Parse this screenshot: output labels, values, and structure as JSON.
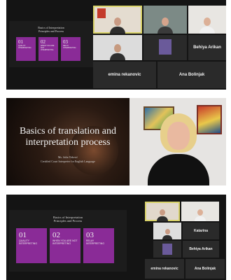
{
  "frame1": {
    "slide": {
      "title_line1": "Basics of Interpretation",
      "title_line2": "Principles and Process",
      "cards": [
        {
          "num": "01",
          "text": "Quality interpreting"
        },
        {
          "num": "02",
          "text": "When you are not interpreting"
        },
        {
          "num": "03",
          "text": "Relay interpreting"
        }
      ]
    },
    "participants": {
      "big_name_1": "Behiya Arikan",
      "big_name_2": "emina rekanovic",
      "big_name_3": "Ana Bolinjak"
    }
  },
  "frame2": {
    "slide": {
      "title": "Basics of translation and interpretation process",
      "presenter": "Ms. Julia Vidović",
      "role": "Certified Court Interpreter for English Language"
    }
  },
  "frame3": {
    "slide": {
      "title_line1": "Basics of Interpretation",
      "title_line2": "Principles and Process",
      "cards": [
        {
          "num": "01",
          "text": "Quality interpreting"
        },
        {
          "num": "02",
          "text": "When you are not interpreting"
        },
        {
          "num": "03",
          "text": "Relay interpreting"
        }
      ]
    },
    "participants": {
      "big_name_1": "Katarina",
      "big_name_2": "Behiya Arikan",
      "big_name_3": "emina rekanovic",
      "big_name_4": "Ana Bolinjak"
    }
  }
}
